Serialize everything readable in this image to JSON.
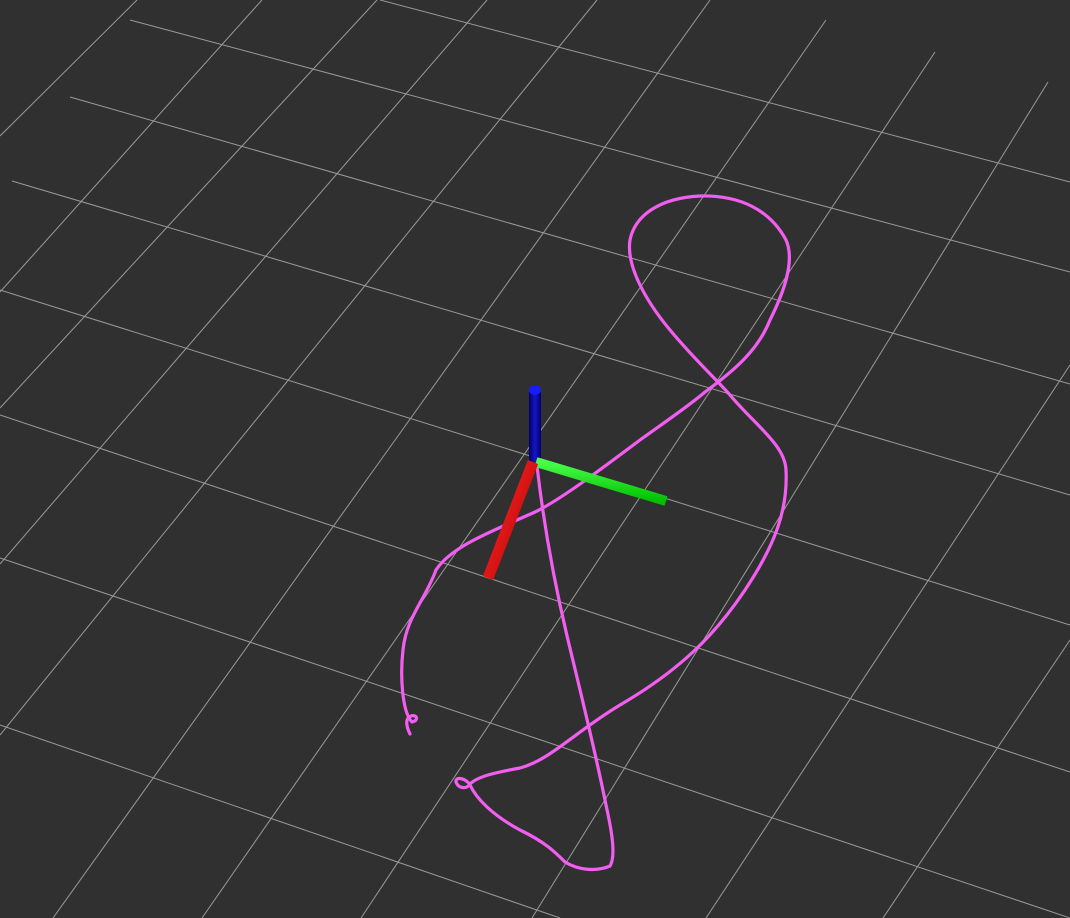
{
  "viewport": {
    "background_color": "#303030",
    "grid": {
      "visible": true,
      "line_color": "#9a9a9a"
    },
    "trajectory": {
      "color": "#f25ff0"
    },
    "axes": {
      "x_axis_color": "#ff0000",
      "y_axis_color": "#00ff00",
      "z_axis_color": "#0000b4"
    }
  }
}
